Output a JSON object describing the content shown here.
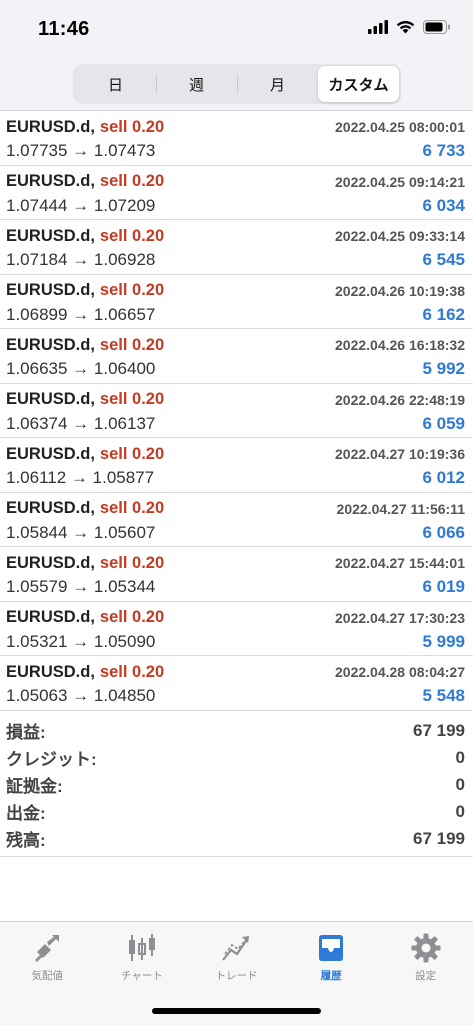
{
  "status_bar": {
    "time": "11:46"
  },
  "segments": [
    {
      "label": "日",
      "active": false
    },
    {
      "label": "週",
      "active": false
    },
    {
      "label": "月",
      "active": false
    },
    {
      "label": "カスタム",
      "active": true
    }
  ],
  "deals": [
    {
      "symbol": "EURUSD.d,",
      "type": "sell 0.20",
      "time": "2022.04.25 08:00:01",
      "prices": "1.07735 → 1.07473",
      "profit": "6 733"
    },
    {
      "symbol": "EURUSD.d,",
      "type": "sell 0.20",
      "time": "2022.04.25 09:14:21",
      "prices": "1.07444 → 1.07209",
      "profit": "6 034"
    },
    {
      "symbol": "EURUSD.d,",
      "type": "sell 0.20",
      "time": "2022.04.25 09:33:14",
      "prices": "1.07184 → 1.06928",
      "profit": "6 545"
    },
    {
      "symbol": "EURUSD.d,",
      "type": "sell 0.20",
      "time": "2022.04.26 10:19:38",
      "prices": "1.06899 → 1.06657",
      "profit": "6 162"
    },
    {
      "symbol": "EURUSD.d,",
      "type": "sell 0.20",
      "time": "2022.04.26 16:18:32",
      "prices": "1.06635 → 1.06400",
      "profit": "5 992"
    },
    {
      "symbol": "EURUSD.d,",
      "type": "sell 0.20",
      "time": "2022.04.26 22:48:19",
      "prices": "1.06374 → 1.06137",
      "profit": "6 059"
    },
    {
      "symbol": "EURUSD.d,",
      "type": "sell 0.20",
      "time": "2022.04.27 10:19:36",
      "prices": "1.06112 → 1.05877",
      "profit": "6 012"
    },
    {
      "symbol": "EURUSD.d,",
      "type": "sell 0.20",
      "time": "2022.04.27 11:56:11",
      "prices": "1.05844 → 1.05607",
      "profit": "6 066"
    },
    {
      "symbol": "EURUSD.d,",
      "type": "sell 0.20",
      "time": "2022.04.27 15:44:01",
      "prices": "1.05579 → 1.05344",
      "profit": "6 019"
    },
    {
      "symbol": "EURUSD.d,",
      "type": "sell 0.20",
      "time": "2022.04.27 17:30:23",
      "prices": "1.05321 → 1.05090",
      "profit": "5 999"
    },
    {
      "symbol": "EURUSD.d,",
      "type": "sell 0.20",
      "time": "2022.04.28 08:04:27",
      "prices": "1.05063 → 1.04850",
      "profit": "5 548"
    }
  ],
  "summary": [
    {
      "label": "損益:",
      "value": "67 199"
    },
    {
      "label": "クレジット:",
      "value": "0"
    },
    {
      "label": "証拠金:",
      "value": "0"
    },
    {
      "label": "出金:",
      "value": "0"
    },
    {
      "label": "残高:",
      "value": "67 199"
    }
  ],
  "tabs": [
    {
      "label": "気配値",
      "icon": "quotes-icon",
      "active": false
    },
    {
      "label": "チャート",
      "icon": "candlestick-chart-icon",
      "active": false
    },
    {
      "label": "トレード",
      "icon": "trade-icon",
      "active": false
    },
    {
      "label": "履歴",
      "icon": "history-inbox-icon",
      "active": true
    },
    {
      "label": "設定",
      "icon": "gear-icon",
      "active": false
    }
  ],
  "colors": {
    "sell": "#c53a23",
    "profit": "#2e7ad6",
    "active_tab": "#2e7ad6",
    "inactive_tab": "#8e8e93"
  }
}
